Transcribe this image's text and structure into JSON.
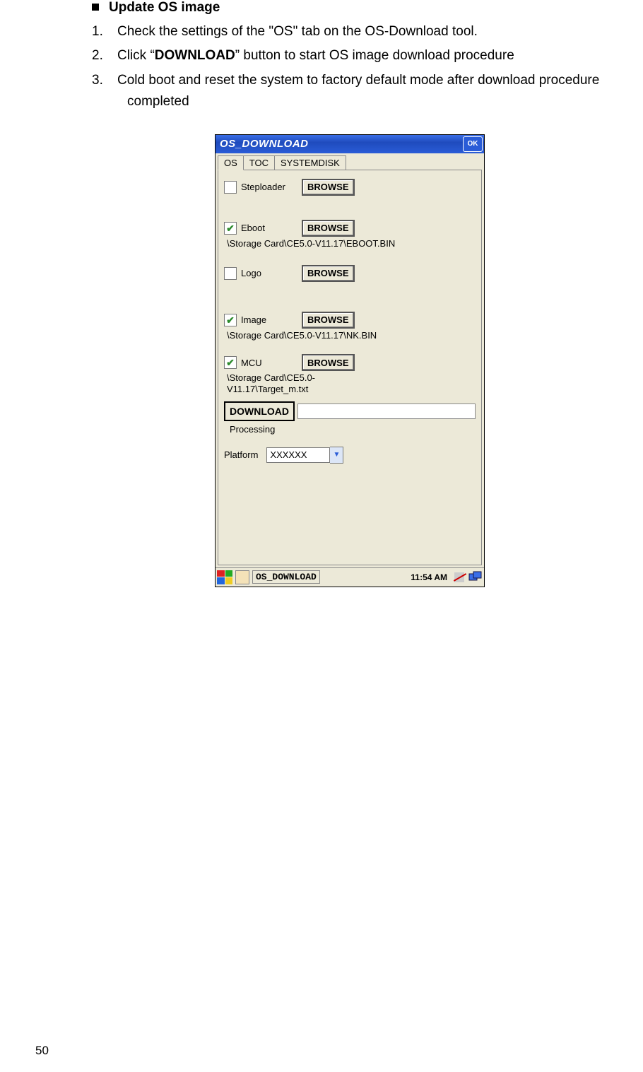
{
  "doc": {
    "heading": "Update OS image",
    "steps": [
      {
        "n": "1.",
        "pre": "Check the settings of the \"OS\" tab on the OS-Download tool.",
        "bold": "",
        "post": ""
      },
      {
        "n": "2.",
        "pre": "Click “",
        "bold": "DOWNLOAD",
        "post": "” button to start OS image download procedure"
      },
      {
        "n": "3.",
        "pre": "Cold boot and reset the system to factory default mode after download procedure completed",
        "bold": "",
        "post": ""
      }
    ],
    "page_number": "50"
  },
  "app": {
    "title": "OS_DOWNLOAD",
    "ok": "OK",
    "tabs": {
      "os": "OS",
      "toc": "TOC",
      "sys": "SYSTEMDISK"
    },
    "items": {
      "steploader": {
        "label": "Steploader",
        "checked": false,
        "path": ""
      },
      "eboot": {
        "label": "Eboot",
        "checked": true,
        "path": "\\Storage Card\\CE5.0-V11.17\\EBOOT.BIN"
      },
      "logo": {
        "label": "Logo",
        "checked": false,
        "path": ""
      },
      "image": {
        "label": "Image",
        "checked": true,
        "path": "\\Storage Card\\CE5.0-V11.17\\NK.BIN"
      },
      "mcu": {
        "label": "MCU",
        "checked": true,
        "path": "\\Storage Card\\CE5.0-V11.17\\Target_m.txt"
      }
    },
    "browse": "BROWSE",
    "download": "DOWNLOAD",
    "processing": "Processing",
    "platform_label": "Platform",
    "platform_value": "XXXXXX",
    "taskbar": {
      "app": "OS_DOWNLOAD",
      "time": "11:54 AM"
    }
  }
}
